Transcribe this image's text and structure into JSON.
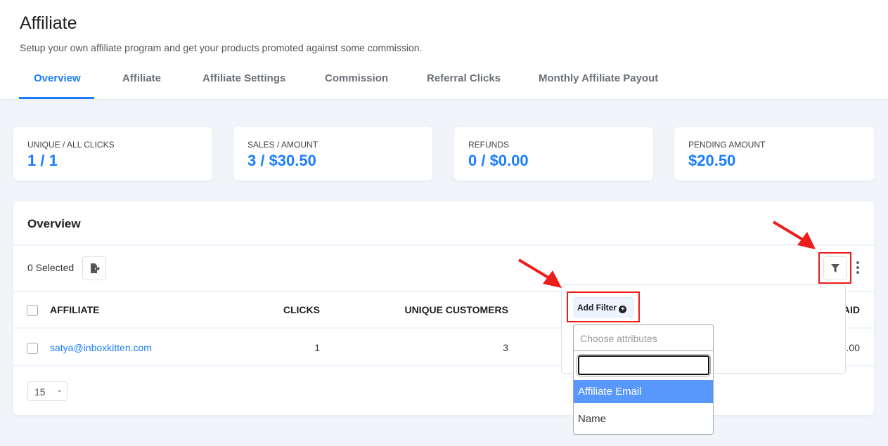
{
  "header": {
    "title": "Affiliate",
    "subtitle": "Setup your own affiliate program and get your products promoted against some commission."
  },
  "tabs": [
    {
      "label": "Overview",
      "active": true
    },
    {
      "label": "Affiliate"
    },
    {
      "label": "Affiliate Settings"
    },
    {
      "label": "Commission"
    },
    {
      "label": "Referral Clicks"
    },
    {
      "label": "Monthly Affiliate Payout"
    }
  ],
  "stats": [
    {
      "label": "UNIQUE / ALL CLICKS",
      "value": "1 / 1"
    },
    {
      "label": "SALES / AMOUNT",
      "value": "3 / $30.50"
    },
    {
      "label": "REFUNDS",
      "value": "0 / $0.00"
    },
    {
      "label": "PENDING AMOUNT",
      "value": "$20.50"
    }
  ],
  "overview": {
    "title": "Overview",
    "selected": "0 Selected",
    "columns": [
      "AFFILIATE",
      "CLICKS",
      "UNIQUE CUSTOMERS",
      "AID"
    ],
    "rows": [
      {
        "affiliate": "satya@inboxkitten.com",
        "clicks": "1",
        "unique_customers": "3",
        "last": ".00"
      }
    ],
    "per_page": "15"
  },
  "filter": {
    "add_filter_label": "Add Filter",
    "placeholder": "Choose attributes",
    "search_value": "",
    "options": [
      {
        "label": "Affiliate Email",
        "highlighted": true
      },
      {
        "label": "Name"
      }
    ]
  },
  "colors": {
    "accent": "#1a7efb",
    "highlight": "#5897fb",
    "annotation": "#ef1c1c"
  }
}
